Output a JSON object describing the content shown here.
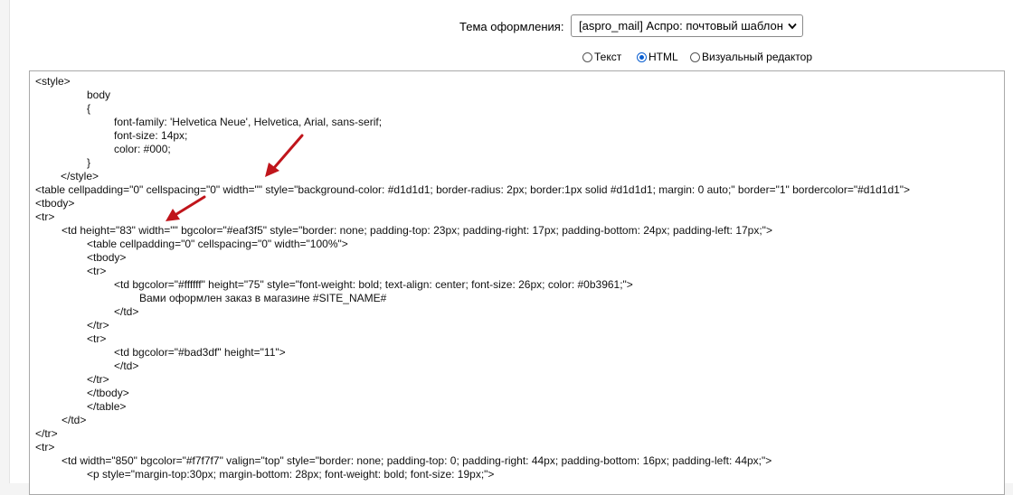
{
  "theme": {
    "label": "Тема оформления:",
    "selected": "[aspro_mail] Аспро: почтовый шаблон"
  },
  "modes": [
    {
      "label": "Текст",
      "checked": false
    },
    {
      "label": "HTML",
      "checked": true
    },
    {
      "label": "Визуальный редактор",
      "checked": false
    }
  ],
  "code_lines": [
    "<style>",
    "body",
    "{",
    "font-family: 'Helvetica Neue', Helvetica, Arial, sans-serif;",
    "font-size: 14px;",
    "color: #000;",
    "}",
    "</style>",
    "<table cellpadding=\"0\" cellspacing=\"0\" width=\"\" style=\"background-color: #d1d1d1; border-radius: 2px; border:1px solid #d1d1d1; margin: 0 auto;\" border=\"1\" bordercolor=\"#d1d1d1\">",
    "<tbody>",
    "<tr>",
    "<td height=\"83\" width=\"\" bgcolor=\"#eaf3f5\" style=\"border: none; padding-top: 23px; padding-right: 17px; padding-bottom: 24px; padding-left: 17px;\">",
    "<table cellpadding=\"0\" cellspacing=\"0\" width=\"100%\">",
    "<tbody>",
    "<tr>",
    "<td bgcolor=\"#ffffff\" height=\"75\" style=\"font-weight: bold; text-align: center; font-size: 26px; color: #0b3961;\">",
    "Вами оформлен заказ в магазине #SITE_NAME#",
    "</td>",
    "</tr>",
    "<tr>",
    "<td bgcolor=\"#bad3df\" height=\"11\">",
    "</td>",
    "</tr>",
    "</tbody>",
    "</table>",
    "</td>",
    "</tr>",
    "<tr>",
    "<td width=\"850\" bgcolor=\"#f7f7f7\" valign=\"top\" style=\"border: none; padding-top: 0; padding-right: 44px; padding-bottom: 16px; padding-left: 44px;\">",
    "<p style=\"margin-top:30px; margin-bottom: 28px; font-weight: bold; font-size: 19px;\">"
  ],
  "colors": {
    "arrow": "#c0151b",
    "radio_accent": "#0a5fd1"
  }
}
